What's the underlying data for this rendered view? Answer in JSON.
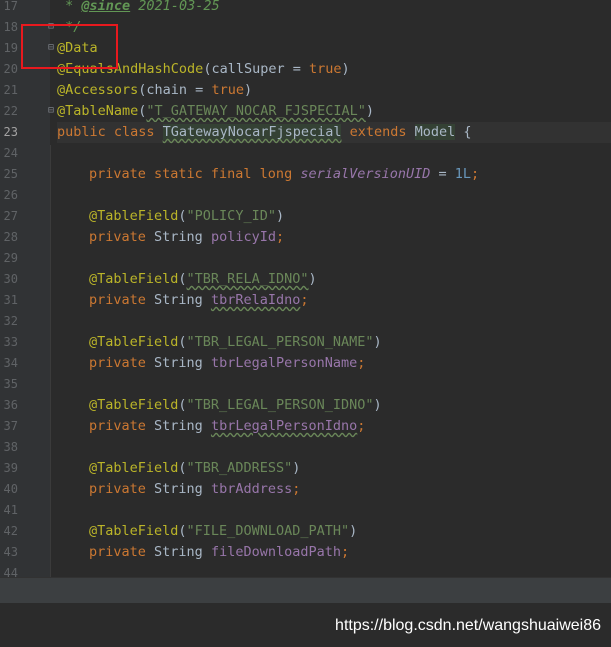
{
  "editor": {
    "current_line": 23,
    "lines": [
      {
        "n": "17",
        "doc_prefix": " * ",
        "doc_tag": "@since",
        "doc_rest": " 2021-03-25"
      },
      {
        "n": "18",
        "doc_close": " */"
      },
      {
        "n": "19",
        "ann": "@Data"
      },
      {
        "n": "20",
        "ann": "@EqualsAndHashCode",
        "p1": "(callSuper = ",
        "kw1": "true",
        "p2": ")"
      },
      {
        "n": "21",
        "ann": "@Accessors",
        "p1": "(chain = ",
        "kw1": "true",
        "p2": ")"
      },
      {
        "n": "22",
        "ann": "@TableName",
        "p1": "(",
        "str": "\"T_GATEWAY_NOCAR_FJSPECIAL\"",
        "p2": ")"
      },
      {
        "n": "23",
        "kw1": "public class ",
        "cls": "TGatewayNocarFjspecial",
        "kw2": " extends ",
        "cls2": "Model",
        "p2": " {"
      },
      {
        "n": "24"
      },
      {
        "n": "25",
        "kw1": "private static final long ",
        "sfield": "serialVersionUID",
        "p1": " = ",
        "num": "1L",
        "p2": ";"
      },
      {
        "n": "26"
      },
      {
        "n": "27",
        "ann": "@TableField",
        "p1": "(",
        "str": "\"POLICY_ID\"",
        "p2": ")"
      },
      {
        "n": "28",
        "kw1": "private ",
        "type": "String ",
        "field": "policyId",
        "p2": ";"
      },
      {
        "n": "29"
      },
      {
        "n": "30",
        "ann": "@TableField",
        "p1": "(",
        "str": "\"TBR_RELA_IDNO\"",
        "p2": ")"
      },
      {
        "n": "31",
        "kw1": "private ",
        "type": "String ",
        "field": "tbrRelaIdno",
        "p2": ";"
      },
      {
        "n": "32"
      },
      {
        "n": "33",
        "ann": "@TableField",
        "p1": "(",
        "str": "\"TBR_LEGAL_PERSON_NAME\"",
        "p2": ")"
      },
      {
        "n": "34",
        "kw1": "private ",
        "type": "String ",
        "field": "tbrLegalPersonName",
        "p2": ";"
      },
      {
        "n": "35"
      },
      {
        "n": "36",
        "ann": "@TableField",
        "p1": "(",
        "str": "\"TBR_LEGAL_PERSON_IDNO\"",
        "p2": ")"
      },
      {
        "n": "37",
        "kw1": "private ",
        "type": "String ",
        "field": "tbrLegalPersonIdno",
        "p2": ";"
      },
      {
        "n": "38"
      },
      {
        "n": "39",
        "ann": "@TableField",
        "p1": "(",
        "str": "\"TBR_ADDRESS\"",
        "p2": ")"
      },
      {
        "n": "40",
        "kw1": "private ",
        "type": "String ",
        "field": "tbrAddress",
        "p2": ";"
      },
      {
        "n": "41"
      },
      {
        "n": "42",
        "ann": "@TableField",
        "p1": "(",
        "str": "\"FILE_DOWNLOAD_PATH\"",
        "p2": ")"
      },
      {
        "n": "43",
        "kw1": "private ",
        "type": "String ",
        "field": "fileDownloadPath",
        "p2": ";"
      },
      {
        "n": "44"
      }
    ]
  },
  "watermark": "https://blog.csdn.net/wangshuaiwei86",
  "colors": {
    "background": "#2b2b2b",
    "keyword": "#cc7832",
    "annotation": "#bbb529",
    "string": "#6a8759",
    "field": "#9876aa",
    "number": "#6897bb",
    "highlight_box": "#e8191e"
  }
}
